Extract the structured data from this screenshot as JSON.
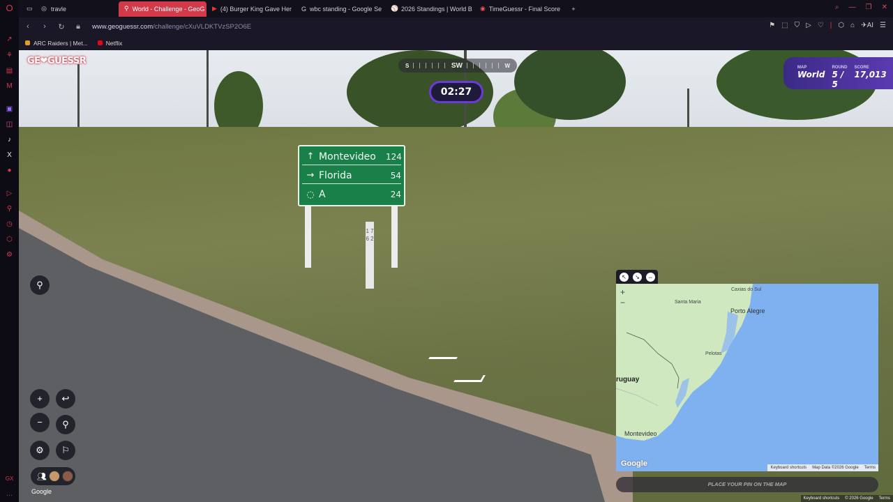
{
  "tabs": [
    {
      "label": "travle",
      "icon": "compass-icon",
      "active": false
    },
    {
      "label": "World - Challenge - GeoG",
      "icon": "map-pin-icon",
      "active": true
    },
    {
      "label": "(4) Burger King Gave Her",
      "icon": "youtube-icon",
      "active": false
    },
    {
      "label": "wbc standing - Google Se",
      "icon": "google-icon",
      "active": false
    },
    {
      "label": "2026 Standings | World B",
      "icon": "baseball-icon",
      "active": false
    },
    {
      "label": "TimeGuessr - Final Score",
      "icon": "timeguessr-icon",
      "active": false
    }
  ],
  "address": {
    "host": "www.geoguessr.com",
    "path": "/challenge/cXuVLDKTVzSP2O6E"
  },
  "bookmarks": [
    {
      "label": "ARC Raiders | Met...",
      "color": "#e39b2a"
    },
    {
      "label": "Netflix",
      "color": "#e50914"
    }
  ],
  "toolbar": {
    "ai_label": "AI"
  },
  "game": {
    "logo": "GE❤GUESSR",
    "compass": {
      "left": "S",
      "center": "SW",
      "right": "W"
    },
    "timer": "02:27",
    "stats": [
      {
        "label": "MAP",
        "value": "World"
      },
      {
        "label": "ROUND",
        "value": "5 / 5"
      },
      {
        "label": "SCORE",
        "value": "17,013"
      }
    ],
    "google_label": "Google",
    "place_pin": "PLACE YOUR PIN ON THE MAP"
  },
  "sign": [
    {
      "arrow": "↑",
      "dest": "Montevideo",
      "km": "124"
    },
    {
      "arrow": "→",
      "dest": "Florida",
      "km": "54"
    },
    {
      "arrow": "",
      "dest": "A",
      "km": "24"
    }
  ],
  "km_post": "1 7 6 2",
  "map": {
    "labels": {
      "caxias": "Caxias do Sul",
      "santa_maria": "Santa Maria",
      "porto_alegre": "Porto Alegre",
      "pelotas": "Pelotas",
      "uruguay": "ruguay",
      "montevideo": "Montevideo"
    },
    "google": "Google",
    "footer": [
      "Keyboard shortcuts",
      "Map Data ©2026 Google",
      "Terms"
    ]
  },
  "page_footer": [
    "Keyboard shortcuts",
    "© 2026 Google",
    "Terms"
  ],
  "colors": {
    "accent": "#d23a4a",
    "timer_ring": "#6a3bd6",
    "map_water": "#7fb0f0",
    "map_land": "#cfe8c0"
  }
}
